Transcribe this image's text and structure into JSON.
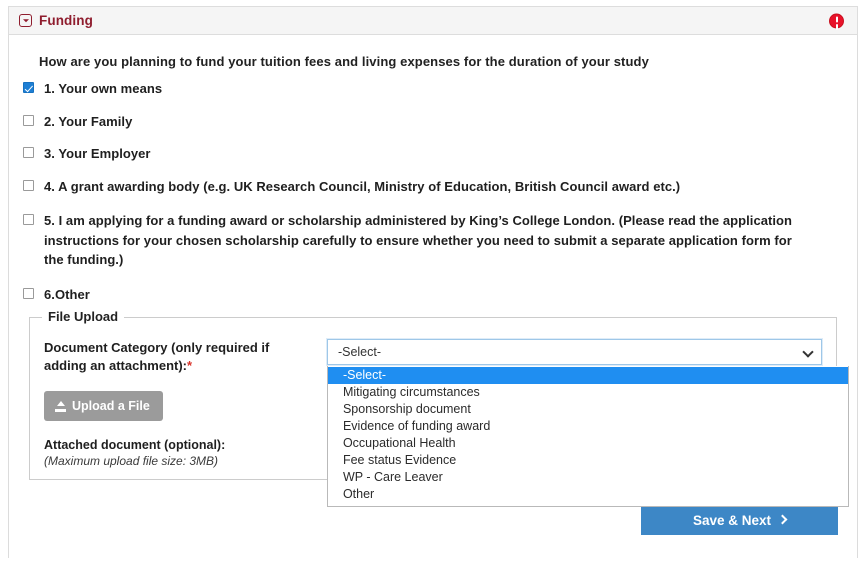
{
  "panel": {
    "title": "Funding",
    "collapse_icon": "collapse-toggle-icon",
    "error_icon": "error-exclamation-icon"
  },
  "question": "How are you planning to fund your tuition fees and living expenses for the duration of your study",
  "options": [
    {
      "label": "1. Your own means",
      "checked": true
    },
    {
      "label": "2. Your Family",
      "checked": false
    },
    {
      "label": "3. Your Employer",
      "checked": false
    },
    {
      "label": "4. A grant awarding body (e.g. UK Research Council, Ministry of Education, British Council award etc.)",
      "checked": false
    },
    {
      "label": "5. I am applying for a funding award or scholarship administered by King’s College London. (Please read the application instructions for your chosen scholarship carefully to ensure whether you need to submit a separate application form for the funding.)",
      "checked": false
    },
    {
      "label": "6.Other",
      "checked": false
    }
  ],
  "file_upload": {
    "legend": "File Upload",
    "doc_category_label": "Document Category (only required if adding an attachment):",
    "required_mark": "*",
    "upload_button_label": "Upload a File",
    "upload_icon": "upload-arrow-icon",
    "attached_label": "Attached document (optional):",
    "max_size_note": "(Maximum upload file size: 3MB)",
    "select": {
      "value": "-Select-",
      "expanded": true,
      "chevron_icon": "chevron-down-icon",
      "highlighted_index": 0,
      "options": [
        "-Select-",
        "Mitigating circumstances",
        "Sponsorship document",
        "Evidence of funding award",
        "Occupational Health",
        "Fee status Evidence",
        "WP - Care Leaver",
        "Other"
      ]
    }
  },
  "footer": {
    "save_label": "Save & Next",
    "save_icon": "chevron-right-icon"
  },
  "colors": {
    "brand_red": "#8f1d2e",
    "error_red": "#e8122a",
    "accent_blue": "#3d87c6",
    "highlight_blue": "#1f8ef1",
    "checkbox_blue": "#1e7fd4",
    "required_red": "#d9342b",
    "upload_gray": "#9b9b9b",
    "header_bg": "#f5f5f5"
  }
}
